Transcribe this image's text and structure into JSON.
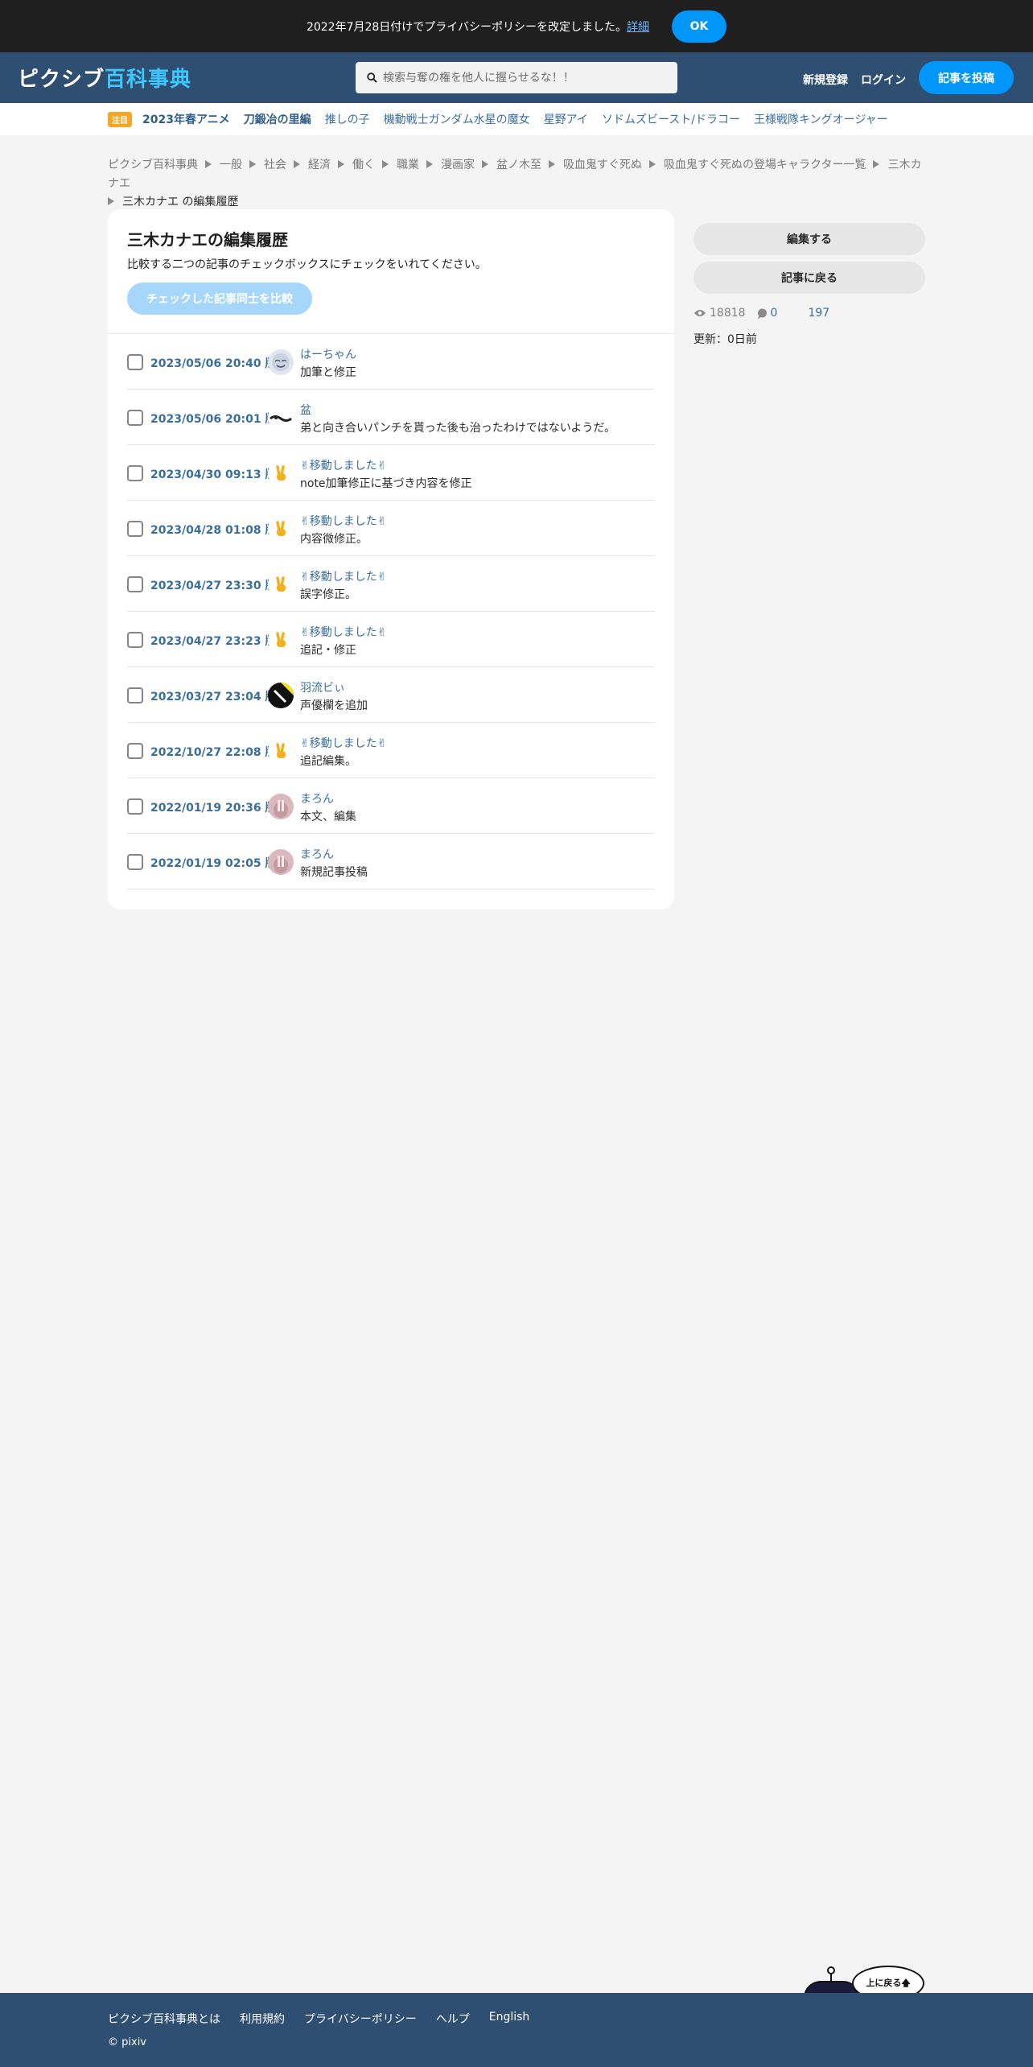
{
  "notice": {
    "text": "2022年7月28日付けでプライバシーポリシーを改定しました。",
    "link": "詳細",
    "ok": "OK"
  },
  "header": {
    "logo_part1": "ピクシブ",
    "logo_part2": "百科事典",
    "search_placeholder": "検索与奪の権を他人に握らせるな！！",
    "signup": "新規登録",
    "login": "ログイン",
    "post": "記事を投稿"
  },
  "trending": {
    "badge": "注目",
    "items": [
      "2023年春アニメ",
      "刀鍛冶の里編",
      "推しの子",
      "機動戦士ガンダム水星の魔女",
      "星野アイ",
      "ソドムズビースト/ドラコー",
      "王様戦隊キングオージャー"
    ]
  },
  "breadcrumb": [
    "ピクシブ百科事典",
    "一般",
    "社会",
    "経済",
    "働く",
    "職業",
    "漫画家",
    "盆ノ木至",
    "吸血鬼すぐ死ぬ",
    "吸血鬼すぐ死ぬの登場キャラクター一覧",
    "三木カナエ",
    "三木カナエ の編集履歴"
  ],
  "main": {
    "title": "三木カナエの編集履歴",
    "description": "比較する二つの記事のチェックボックスにチェックをいれてください。",
    "compare_button": "チェックした記事同士を比較",
    "revisions": [
      {
        "date": "2023/05/06 20:40 版",
        "user": "はーちゃん",
        "comment": "加筆と修正"
      },
      {
        "date": "2023/05/06 20:01 版",
        "user": "盆",
        "comment": "弟と向き合いパンチを貰った後も治ったわけではないようだ。"
      },
      {
        "date": "2023/04/30 09:13 版",
        "user": "✌移動しました✌",
        "comment": "note加筆修正に基づき内容を修正"
      },
      {
        "date": "2023/04/28 01:08 版",
        "user": "✌移動しました✌",
        "comment": "内容微修正。"
      },
      {
        "date": "2023/04/27 23:30 版",
        "user": "✌移動しました✌",
        "comment": "誤字修正。"
      },
      {
        "date": "2023/04/27 23:23 版",
        "user": "✌移動しました✌",
        "comment": "追記・修正"
      },
      {
        "date": "2023/03/27 23:04 版",
        "user": "羽流ビぃ",
        "comment": "声優欄を追加"
      },
      {
        "date": "2022/10/27 22:08 版",
        "user": "✌移動しました✌",
        "comment": "追記編集。"
      },
      {
        "date": "2022/01/19 20:36 版",
        "user": "まろん",
        "comment": "本文、編集"
      },
      {
        "date": "2022/01/19 02:05 版",
        "user": "まろん",
        "comment": "新規記事投稿"
      }
    ]
  },
  "sidebar": {
    "edit_button": "編集する",
    "back_button": "記事に戻る",
    "views": "18818",
    "comments": "0",
    "third_stat": "197",
    "updated": "更新：0日前"
  },
  "footer": {
    "links": [
      "ピクシブ百科事典とは",
      "利用規約",
      "プライバシーポリシー",
      "ヘルプ",
      "English"
    ],
    "copyright": "© pixiv",
    "back_to_top": "上に戻る🡅"
  },
  "colors": {
    "header_bg": "#2f4f72",
    "accent_blue": "#0096fa",
    "link_blue": "#3a6e9c",
    "logo_cyan": "#3ec6ff",
    "badge_orange": "#f5a623"
  }
}
